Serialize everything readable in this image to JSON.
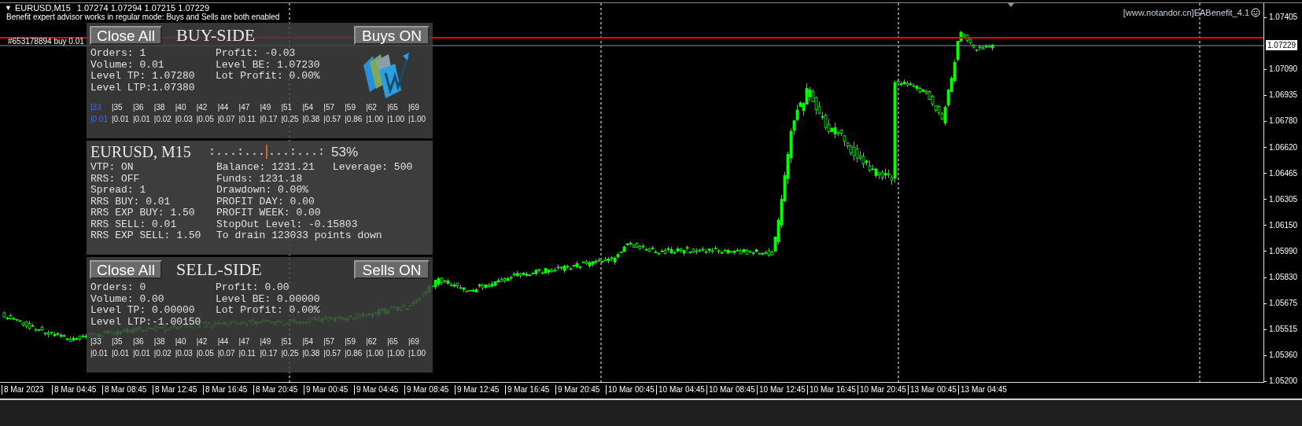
{
  "chart_header": {
    "arrow": "▼",
    "symbol": "EURUSD,M15",
    "ohlc": "1.07274 1.07294 1.07215 1.07229"
  },
  "ea_status": "Benefit expert advisor works in regular mode: Buys and Sells are both enabled",
  "order_line": {
    "label": "#653178894 buy 0.01"
  },
  "ea_label": "[www.notandor.cn]EABenefit_4.1",
  "price_axis": {
    "labels": [
      "1.07405",
      "1.07090",
      "1.06935",
      "1.06780",
      "1.06620",
      "1.06465",
      "1.06305",
      "1.06150",
      "1.05990",
      "1.05830",
      "1.05675",
      "1.05515",
      "1.05360",
      "1.05200"
    ],
    "current_price": "1.07229"
  },
  "time_axis": {
    "labels": [
      "8 Mar 2023",
      "8 Mar 04:45",
      "8 Mar 08:45",
      "8 Mar 12:45",
      "8 Mar 16:45",
      "8 Mar 20:45",
      "9 Mar 00:45",
      "9 Mar 04:45",
      "9 Mar 08:45",
      "9 Mar 12:45",
      "9 Mar 16:45",
      "9 Mar 20:45",
      "10 Mar 00:45",
      "10 Mar 04:45",
      "10 Mar 08:45",
      "10 Mar 12:45",
      "10 Mar 16:45",
      "10 Mar 20:45",
      "13 Mar 00:45",
      "13 Mar 04:45"
    ]
  },
  "buy_panel": {
    "close_button": "Close All",
    "title": "BUY-SIDE",
    "toggle_button": "Buys ON",
    "stats_left": [
      "Orders: 1",
      "Volume: 0.01",
      "Level TP: 1.07280",
      "Level LTP:1.07380"
    ],
    "stats_right": [
      "Profit: -0.03",
      "Level BE: 1.07230",
      "Lot Profit: 0.00%"
    ],
    "grid": [
      {
        "step": "|33",
        "lot": "|0.01",
        "selected": true
      },
      {
        "step": "|35",
        "lot": "|0.01",
        "selected": false
      },
      {
        "step": "|36",
        "lot": "|0.01",
        "selected": false
      },
      {
        "step": "|38",
        "lot": "|0.02",
        "selected": false
      },
      {
        "step": "|40",
        "lot": "|0.03",
        "selected": false
      },
      {
        "step": "|42",
        "lot": "|0.05",
        "selected": false
      },
      {
        "step": "|44",
        "lot": "|0.07",
        "selected": false
      },
      {
        "step": "|47",
        "lot": "|0.11",
        "selected": false
      },
      {
        "step": "|49",
        "lot": "|0.17",
        "selected": false
      },
      {
        "step": "|51",
        "lot": "|0.25",
        "selected": false
      },
      {
        "step": "|54",
        "lot": "|0.38",
        "selected": false
      },
      {
        "step": "|57",
        "lot": "|0.57",
        "selected": false
      },
      {
        "step": "|59",
        "lot": "|0.86",
        "selected": false
      },
      {
        "step": "|62",
        "lot": "|1.00",
        "selected": false
      },
      {
        "step": "|65",
        "lot": "|1.00",
        "selected": false
      },
      {
        "step": "|69",
        "lot": "|1.00",
        "selected": false
      }
    ]
  },
  "account_panel": {
    "title": "EURUSD, M15",
    "progress_left": ":...:...",
    "progress_right": "...:...:",
    "percent": "53%",
    "stats_left": [
      "VTP: ON",
      "RRS: OFF",
      "Spread: 1",
      "RRS BUY: 0.01",
      "RRS EXP BUY: 1.50",
      "RRS SELL: 0.01",
      "RRS EXP SELL: 1.50"
    ],
    "stats_right": [
      "Balance: 1231.21",
      "Funds: 1231.18",
      "Drawdown: 0.00%",
      "PROFIT DAY: 0.00",
      "PROFIT WEEK: 0.00",
      "StopOut Level: -0.15803",
      "To drain 123033 points down"
    ],
    "leverage": "Leverage: 500"
  },
  "sell_panel": {
    "close_button": "Close All",
    "title": "SELL-SIDE",
    "toggle_button": "Sells ON",
    "stats_left": [
      "Orders: 0",
      "Volume: 0.00",
      "Level TP: 0.00000",
      "Level LTP:-1.00150"
    ],
    "stats_right": [
      "Profit: 0.00",
      "Level BE: 0.00000",
      "Lot Profit: 0.00%"
    ],
    "grid": [
      {
        "step": "|33",
        "lot": "|0.01",
        "selected": false
      },
      {
        "step": "|35",
        "lot": "|0.01",
        "selected": false
      },
      {
        "step": "|36",
        "lot": "|0.01",
        "selected": false
      },
      {
        "step": "|38",
        "lot": "|0.02",
        "selected": false
      },
      {
        "step": "|40",
        "lot": "|0.03",
        "selected": false
      },
      {
        "step": "|42",
        "lot": "|0.05",
        "selected": false
      },
      {
        "step": "|44",
        "lot": "|0.07",
        "selected": false
      },
      {
        "step": "|47",
        "lot": "|0.11",
        "selected": false
      },
      {
        "step": "|49",
        "lot": "|0.17",
        "selected": false
      },
      {
        "step": "|51",
        "lot": "|0.25",
        "selected": false
      },
      {
        "step": "|54",
        "lot": "|0.38",
        "selected": false
      },
      {
        "step": "|57",
        "lot": "|0.57",
        "selected": false
      },
      {
        "step": "|59",
        "lot": "|0.86",
        "selected": false
      },
      {
        "step": "|62",
        "lot": "|1.00",
        "selected": false
      },
      {
        "step": "|65",
        "lot": "|1.00",
        "selected": false
      },
      {
        "step": "|69",
        "lot": "|1.00",
        "selected": false
      }
    ]
  }
}
